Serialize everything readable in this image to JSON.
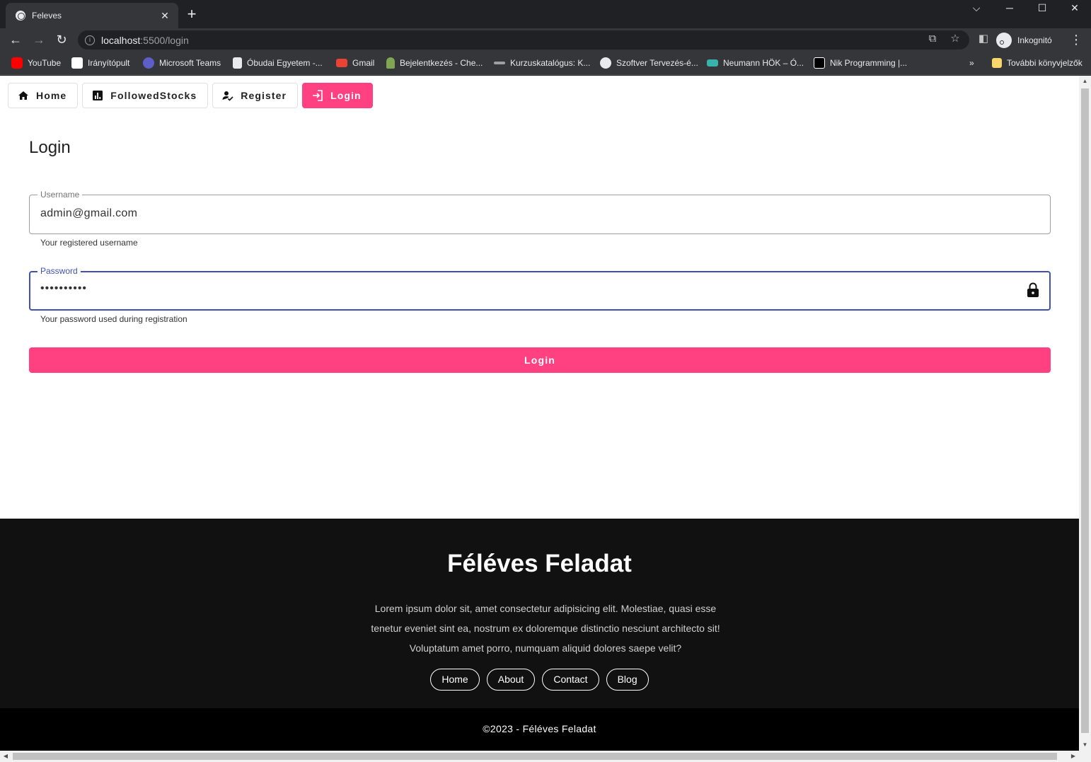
{
  "browser": {
    "tab_title": "Feleves",
    "tab_close": "✕",
    "new_tab": "+",
    "url_host": "localhost",
    "url_path": ":5500/login",
    "profile_label": "Inkognitó",
    "bookmarks": [
      {
        "label": "YouTube",
        "icon": "youtube-icon",
        "color": "#ff0000"
      },
      {
        "label": "Irányítópult",
        "icon": "oe-icon",
        "color": "#ffffff"
      },
      {
        "label": "Microsoft Teams",
        "icon": "teams-icon",
        "color": "#5b5fc7"
      },
      {
        "label": "Óbudai Egyetem -...",
        "icon": "document-icon",
        "color": "#e8eaed"
      },
      {
        "label": "Gmail",
        "icon": "gmail-icon",
        "color": "#ea4335"
      },
      {
        "label": "Bejelentkezés - Che...",
        "icon": "chess-icon",
        "color": "#7fa650"
      },
      {
        "label": "Kurzuskatalógus: K...",
        "icon": "link-icon",
        "color": "#9aa0a6"
      },
      {
        "label": "Szoftver Tervezés-é...",
        "icon": "globe-icon",
        "color": "#e8eaed"
      },
      {
        "label": "Neumann HÖK – Ó...",
        "icon": "nh-icon",
        "color": "#38b2ac"
      },
      {
        "label": "Nik Programming |...",
        "icon": "nik-icon",
        "color": "#ffffff"
      }
    ],
    "more_bookmarks": "»",
    "other_bookmarks": "További könyvjelzők"
  },
  "nav": {
    "home": "Home",
    "followed": "FollowedStocks",
    "register": "Register",
    "login": "Login"
  },
  "form": {
    "title": "Login",
    "username_label": "Username",
    "username_value": "admin@gmail.com",
    "username_hint": "Your registered username",
    "password_label": "Password",
    "password_value": "••••••••••",
    "password_hint": "Your password used during registration",
    "submit": "Login"
  },
  "footer": {
    "title": "Féléves Feladat",
    "text": "Lorem ipsum dolor sit, amet consectetur adipisicing elit. Molestiae, quasi esse tenetur eveniet sint ea, nostrum ex doloremque distinctio nesciunt architecto sit! Voluptatum amet porro, numquam aliquid dolores saepe velit?",
    "links": [
      "Home",
      "About",
      "Contact",
      "Blog"
    ],
    "copyright": "©2023 - Féléves Feladat"
  },
  "colors": {
    "accent": "#ff4081",
    "focus": "#3f51b5",
    "footer_bg": "#111111",
    "copyright_bg": "#000000"
  }
}
